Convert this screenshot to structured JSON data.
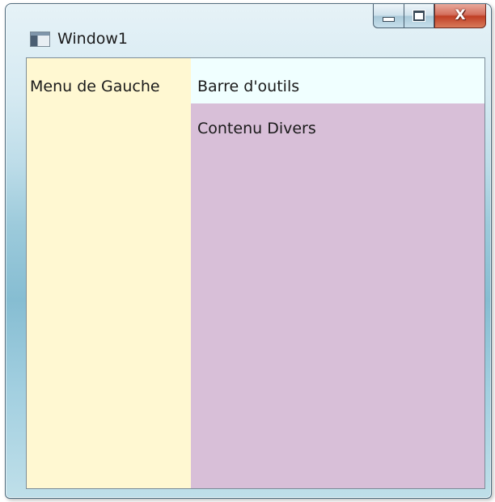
{
  "window": {
    "title": "Window1",
    "icon": "window-app-icon",
    "controls": {
      "minimize_icon": "minimize-icon",
      "maximize_icon": "maximize-icon",
      "close_label": "X"
    }
  },
  "layout": {
    "left_menu_label": "Menu de Gauche",
    "toolbar_label": "Barre d'outils",
    "content_label": "Contenu Divers"
  },
  "colors": {
    "left_menu_bg": "#fff8d2",
    "toolbar_bg": "#f0ffff",
    "content_bg": "#d8bfd8",
    "close_button": "#c7452c"
  }
}
